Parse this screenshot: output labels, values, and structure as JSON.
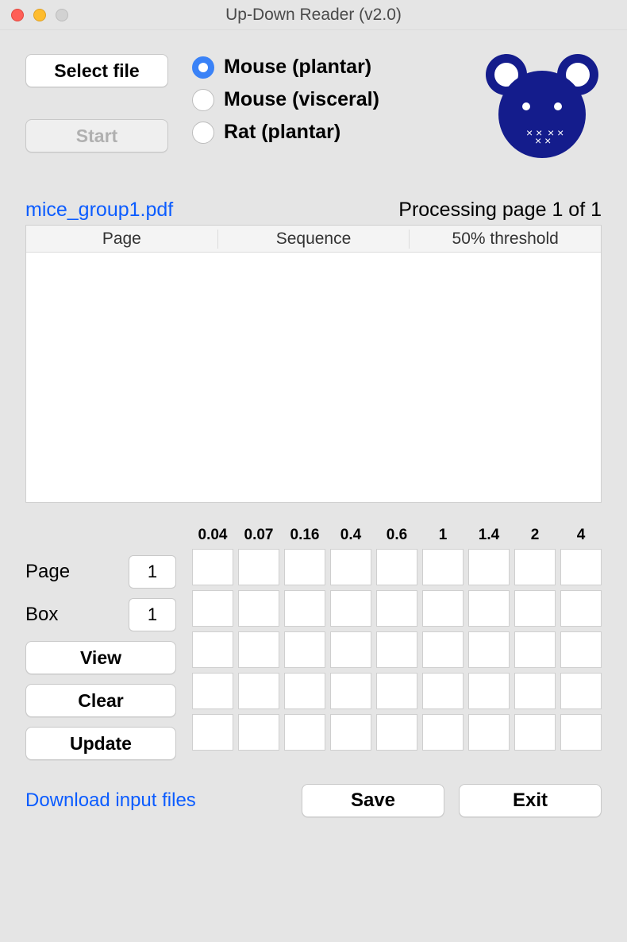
{
  "window": {
    "title": "Up-Down Reader (v2.0)"
  },
  "buttons": {
    "select_file": "Select file",
    "start": "Start",
    "view": "View",
    "clear": "Clear",
    "update": "Update",
    "save": "Save",
    "exit": "Exit"
  },
  "radios": {
    "mouse_plantar": "Mouse (plantar)",
    "mouse_visceral": "Mouse (visceral)",
    "rat_plantar": "Rat (plantar)"
  },
  "file": {
    "name": "mice_group1.pdf"
  },
  "status": {
    "processing": "Processing page 1 of 1"
  },
  "table": {
    "headers": {
      "page": "Page",
      "sequence": "Sequence",
      "threshold": "50% threshold"
    }
  },
  "fields": {
    "page_label": "Page",
    "page_value": "1",
    "box_label": "Box",
    "box_value": "1"
  },
  "grid": {
    "col_headers": [
      "0.04",
      "0.07",
      "0.16",
      "0.4",
      "0.6",
      "1",
      "1.4",
      "2",
      "4"
    ],
    "rows": 5
  },
  "links": {
    "download": "Download input files"
  }
}
